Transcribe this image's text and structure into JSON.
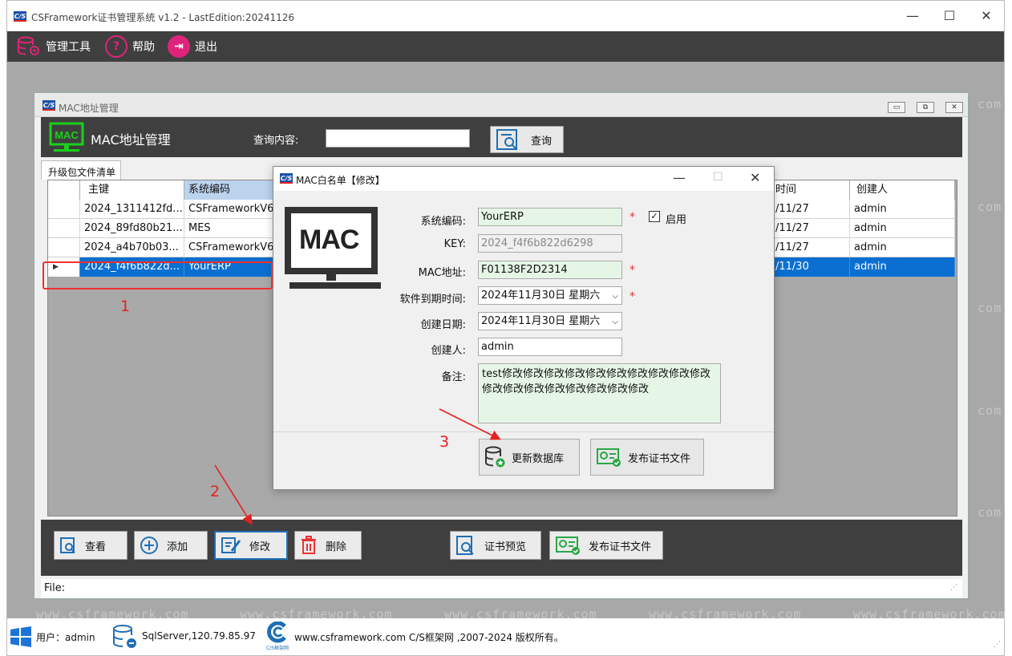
{
  "app": {
    "title": "CSFramework证书管理系统 v1.2 - LastEdition:20241126",
    "logo": "C/S"
  },
  "menu": {
    "items": [
      {
        "label": "管理工具",
        "icon": "database-gear-icon"
      },
      {
        "label": "帮助",
        "icon": "help-icon"
      },
      {
        "label": "退出",
        "icon": "exit-icon"
      }
    ]
  },
  "watermark": "www.csframework.com",
  "watermark_short": ". com",
  "mdi": {
    "title": "MAC地址管理",
    "header_title": "MAC地址管理",
    "query_label": "查询内容:",
    "query_value": "",
    "query_button": "查询",
    "tab": "升级包文件清单"
  },
  "grid": {
    "columns": [
      "主键",
      "系统编码",
      "时间",
      "创建人"
    ],
    "rows": [
      {
        "key": "2024_1311412fd...",
        "code": "CSFrameworkV6",
        "time": "/11/27",
        "creator": "admin"
      },
      {
        "key": "2024_89fd80b21...",
        "code": "MES",
        "time": "/11/27",
        "creator": "admin"
      },
      {
        "key": "2024_a4b70b03...",
        "code": "CSFrameworkV6",
        "time": "/11/27",
        "creator": "admin"
      },
      {
        "key": "2024_f4f6b822d...",
        "code": "YourERP",
        "time": "/11/30",
        "creator": "admin"
      }
    ]
  },
  "toolbar": {
    "view": "查看",
    "add": "添加",
    "edit": "修改",
    "delete": "删除",
    "preview": "证书预览",
    "publish": "发布证书文件"
  },
  "file_label": "File:",
  "statusbar": {
    "user": "用户：admin",
    "db": "SqlServer,120.79.85.97",
    "copyright": "www.csframework.com C/S框架网 ,2007-2024 版权所有。",
    "logo_text": "C/S框架网"
  },
  "dialog": {
    "title": "MAC白名单【修改】",
    "mac_text": "MAC",
    "fields": {
      "sys_code_label": "系统编码:",
      "sys_code": "YourERP",
      "enable_label": "启用",
      "key_label": "KEY:",
      "key": "2024_f4f6b822d6298",
      "mac_label": "MAC地址:",
      "mac": "F01138F2D2314",
      "expire_label": "软件到期时间:",
      "expire": "2024年11月30日 星期六",
      "created_label": "创建日期:",
      "created": "2024年11月30日 星期六",
      "creator_label": "创建人:",
      "creator": "admin",
      "remark_label": "备注:",
      "remark": "test修改修改修改修改修改修改修改修改修改修改修改修改修改修改修改修改修改修改"
    },
    "required_mark": "*",
    "update_btn": "更新数据库",
    "publish_btn": "发布证书文件"
  },
  "annotations": {
    "a1": "1",
    "a2": "2",
    "a3": "3"
  }
}
